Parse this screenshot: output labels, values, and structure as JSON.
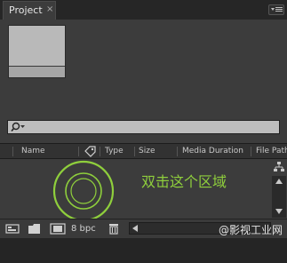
{
  "panel": {
    "tab_label": "Project",
    "close_glyph": "×"
  },
  "columns": [
    {
      "label": "Name"
    },
    {
      "label": "Type"
    },
    {
      "label": "Size"
    },
    {
      "label": "Media Duration"
    },
    {
      "label": "File Path"
    }
  ],
  "hint_text": "双击这个区域",
  "toolbar": {
    "bpc_label": "8 bpc"
  },
  "watermark": "@影视工业网",
  "colors": {
    "accent_green": "#8fcf3c",
    "panel_bg": "#3c3c3c",
    "header_bg": "#262626"
  },
  "icons": {
    "panel_menu": "panel-menu-icon",
    "search": "search-icon",
    "label": "label-tag-icon",
    "flowchart": "flowchart-icon",
    "interpret_footage": "interpret-footage-icon",
    "new_folder": "folder-icon",
    "new_composition": "composition-icon",
    "delete": "trash-icon"
  }
}
